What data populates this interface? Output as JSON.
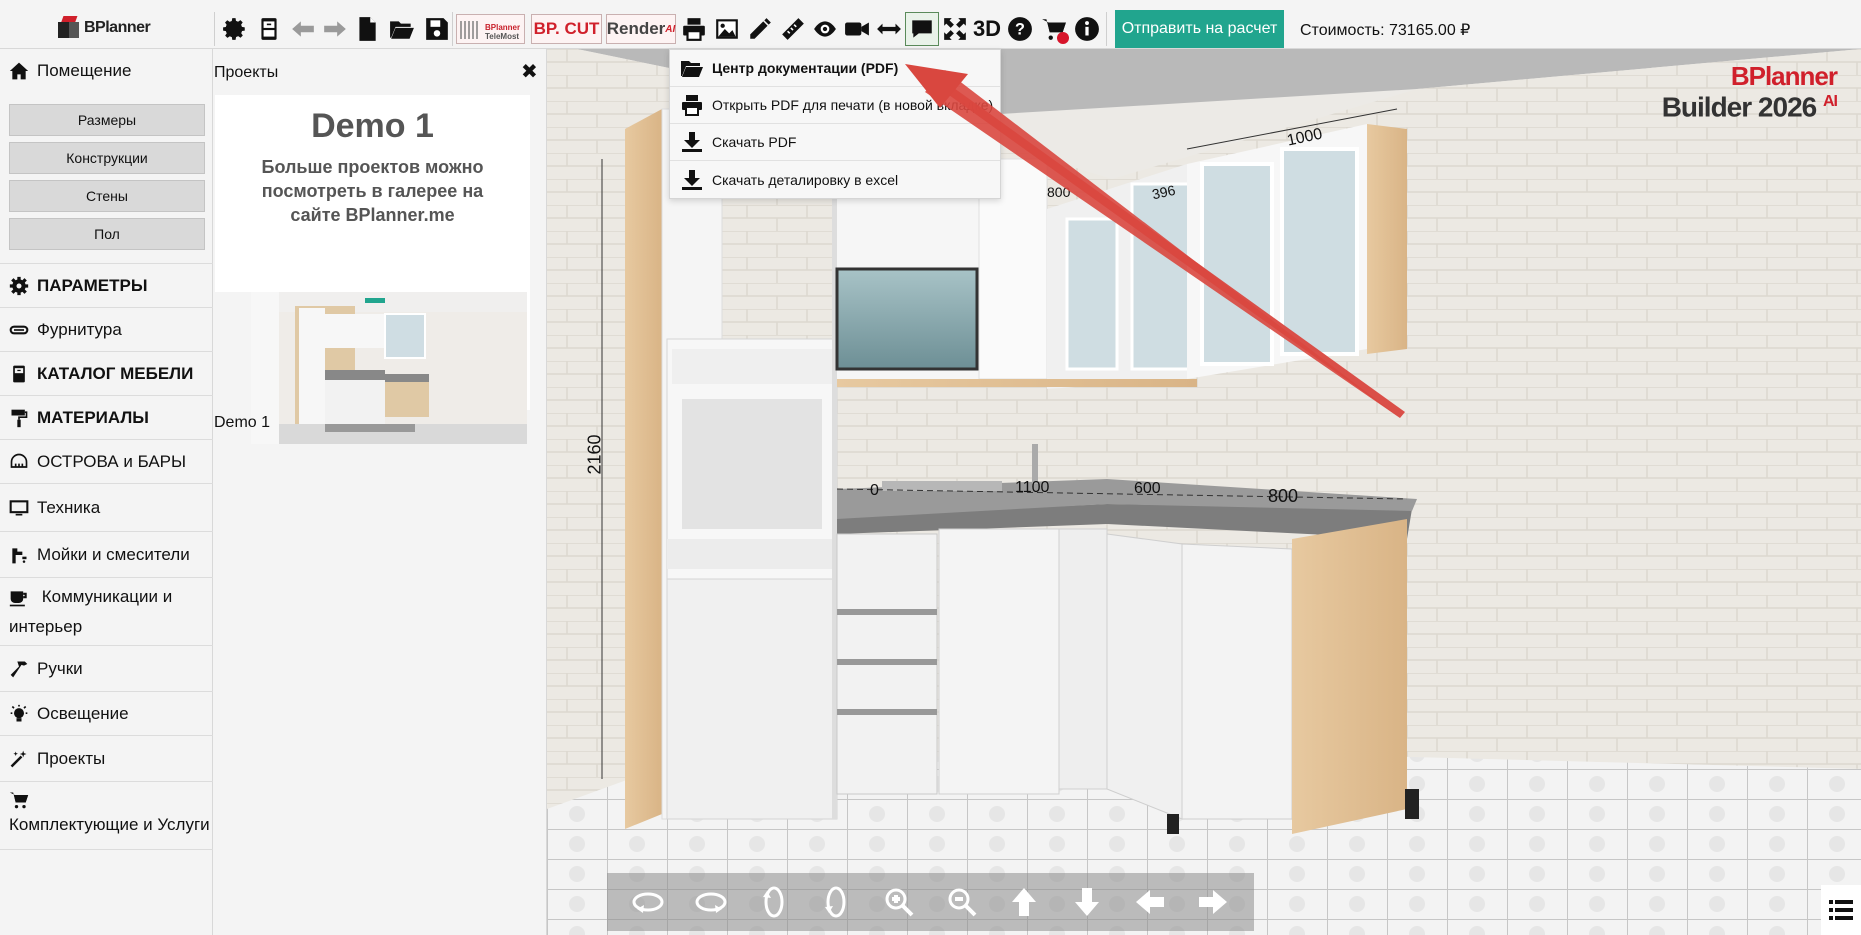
{
  "topbar": {
    "logo_text": "BPlanner",
    "brand_buttons": {
      "telemost_line1": "BPlanner",
      "telemost_line2": "TeleMost",
      "cut": "BP. CUT",
      "render": "Render",
      "render_sup": "AI"
    },
    "label_3d": "3D",
    "send_button": "Отправить на расчет",
    "cost_label": "Стоимость: 73165.00 ₽",
    "icons": [
      "gear-icon",
      "cabinet-icon",
      "undo-icon",
      "redo-icon",
      "new-file-icon",
      "open-folder-icon",
      "save-icon",
      "telemost-icon",
      "cut-icon",
      "render-icon",
      "print-icon",
      "image-icon",
      "pencil-icon",
      "ruler-icon",
      "eye-icon",
      "video-icon",
      "resize-icon",
      "comment-icon",
      "fullscreen-icon",
      "3d-icon",
      "help-icon",
      "cart-icon",
      "info-icon"
    ]
  },
  "sidebar": {
    "room": {
      "label": "Помещение",
      "sub": [
        "Размеры",
        "Конструкции",
        "Стены",
        "Пол"
      ]
    },
    "items": [
      {
        "label": "ПАРАМЕТРЫ",
        "icon": "gear-icon",
        "bold": true
      },
      {
        "label": "Фурнитура",
        "icon": "hardware-icon",
        "bold": false
      },
      {
        "label": "КАТАЛОГ МЕБЕЛИ",
        "icon": "catalog-icon",
        "bold": true
      },
      {
        "label": "МАТЕРИАЛЫ",
        "icon": "paint-roller-icon",
        "bold": true
      },
      {
        "label": "ОСТРОВА и БАРЫ",
        "icon": "island-icon",
        "bold": false
      },
      {
        "label": "Техника",
        "icon": "monitor-icon",
        "bold": false
      },
      {
        "label": "Мойки и смесители",
        "icon": "sink-icon",
        "bold": false
      },
      {
        "label": "Коммуникации и интерьер",
        "icon": "cup-icon",
        "bold": false
      },
      {
        "label": "Ручки",
        "icon": "hammer-icon",
        "bold": false
      },
      {
        "label": "Освещение",
        "icon": "lightbulb-icon",
        "bold": false
      },
      {
        "label": "Проекты",
        "icon": "magic-wand-icon",
        "bold": false
      },
      {
        "label": "Комплектующие и Услуги",
        "icon": "cart-icon",
        "bold": false
      }
    ]
  },
  "projects": {
    "title": "Проекты",
    "close": "✖",
    "card_title": "Demo 1",
    "card_text": "Больше проектов можно посмотреть в галерее на сайте BPlanner.me",
    "project_name": "Demo 1"
  },
  "dropdown": {
    "items": [
      {
        "label": "Центр документации (PDF)",
        "icon": "folder-open-icon"
      },
      {
        "label": "Открыть PDF для печати (в новой вкладке)",
        "icon": "print-icon"
      },
      {
        "label": "Скачать PDF",
        "icon": "download-icon"
      },
      {
        "label": "Скачать деталировку в excel",
        "icon": "download-icon"
      }
    ]
  },
  "viewport": {
    "brand_line1": "BPlanner",
    "brand_line2": "Builder 2026",
    "brand_sup": "AI",
    "dimensions": [
      "2160",
      "1000",
      "800",
      "396",
      "1100",
      "600",
      "800",
      "0"
    ],
    "camera_controls": [
      "rotate-left-icon",
      "rotate-right-icon",
      "rotate-up-icon",
      "rotate-down-icon",
      "zoom-in-icon",
      "zoom-out-icon",
      "move-up-icon",
      "move-down-icon",
      "move-left-icon",
      "move-right-icon"
    ]
  },
  "colors": {
    "accent_green": "#21a58e",
    "brand_red": "#d0202b",
    "arrow_red": "#d9473f"
  }
}
